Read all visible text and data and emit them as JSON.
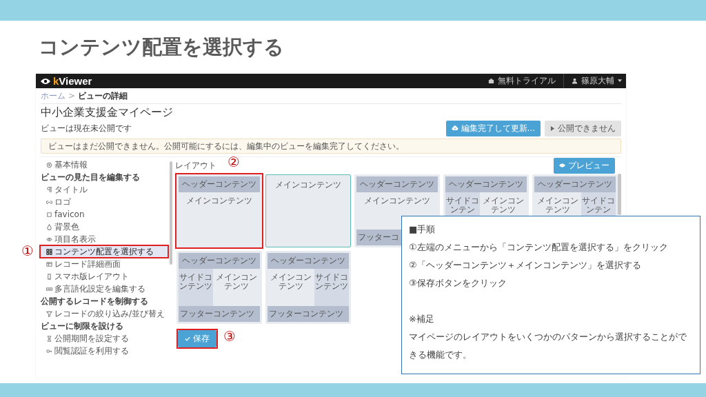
{
  "slide": {
    "title": "コンテンツ配置を選択する"
  },
  "app": {
    "logo": {
      "accent": "k",
      "rest": "Viewer"
    },
    "trial": "無料トライアル",
    "user": "篠原大輔"
  },
  "breadcrumb": {
    "items": [
      "ホーム",
      "ビューの詳細"
    ],
    "separator": ">"
  },
  "page": {
    "title": "中小企業支援金マイページ",
    "status": "ビューは現在未公開です",
    "buttons": [
      {
        "label": "編集完了して更新...",
        "kind": "primary"
      },
      {
        "label": "公開できません",
        "kind": "disabled"
      }
    ],
    "alert": "ビューはまだ公開できません。公開可能にするには、編集中のビューを編集完了してください。"
  },
  "sidebar": {
    "groups": [
      {
        "items": [
          {
            "label": "基本情報",
            "selected": false
          }
        ]
      },
      {
        "title": "ビューの見た目を編集する",
        "items": [
          {
            "label": "タイトル",
            "selected": false
          },
          {
            "label": "ロゴ",
            "selected": false
          },
          {
            "label": "favicon",
            "selected": false
          },
          {
            "label": "背景色",
            "selected": false
          },
          {
            "label": "項目名表示",
            "selected": false
          },
          {
            "label": "コンテンツ配置を選択する",
            "selected": true
          },
          {
            "label": "レコード詳細画面",
            "selected": false
          },
          {
            "label": "スマホ版レイアウト",
            "selected": false
          },
          {
            "label": "多言語化設定を編集する",
            "selected": false
          }
        ]
      },
      {
        "title": "公開するレコードを制御する",
        "items": [
          {
            "label": "レコードの絞り込み/並び替え",
            "selected": false
          }
        ]
      },
      {
        "title": "ビューに制限を設ける",
        "items": [
          {
            "label": "公開期間を設定する",
            "selected": false
          },
          {
            "label": "閲覧認証を利用する",
            "selected": false
          }
        ]
      }
    ]
  },
  "layout": {
    "label": "レイアウト",
    "preview": "プレビュー",
    "save": "保存",
    "cards": [
      {
        "kind": "plain",
        "selected": false,
        "header": "ヘッダーコンテンツ",
        "main": "メインコンテンツ"
      },
      {
        "kind": "plain",
        "selected": true,
        "main": "メインコンテンツ"
      },
      {
        "kind": "plain",
        "selected": false,
        "header": "ヘッダーコンテンツ",
        "main": "メインコンテンツ",
        "footer": "フッターコ"
      },
      {
        "kind": "side-left",
        "selected": false,
        "header": "ヘッダーコンテンツ",
        "main": "メインコンテンツ",
        "side": "サイドコンテン"
      },
      {
        "kind": "side-right",
        "selected": false,
        "header": "ヘッダーコンテンツ",
        "main": "メインコンテンツ",
        "side": "サイドコンテン"
      },
      {
        "kind": "side-left",
        "selected": false,
        "header": "ヘッダーコンテンツ",
        "main": "メインコンテンツ",
        "side": "サイドコンテンツ",
        "footer": "フッターコンテンツ"
      },
      {
        "kind": "side-right",
        "selected": false,
        "header": "ヘッダーコンテンツ",
        "main": "メインコンテンツ",
        "side": "サイドコンテンツ",
        "footer": "フッターコンテンツ"
      }
    ]
  },
  "annotations": {
    "markers": [
      "①",
      "②",
      "③"
    ]
  },
  "note": {
    "heading": "■手順",
    "steps": [
      "①左端のメニューから「コンテンツ配置を選択する」をクリック",
      "②「ヘッダーコンテンツ＋メインコンテンツ」を選択する",
      "③保存ボタンをクリック"
    ],
    "supplement_heading": "※補足",
    "supplement": "マイページのレイアウトをいくつかのパターンから選択することができる機能です。"
  }
}
